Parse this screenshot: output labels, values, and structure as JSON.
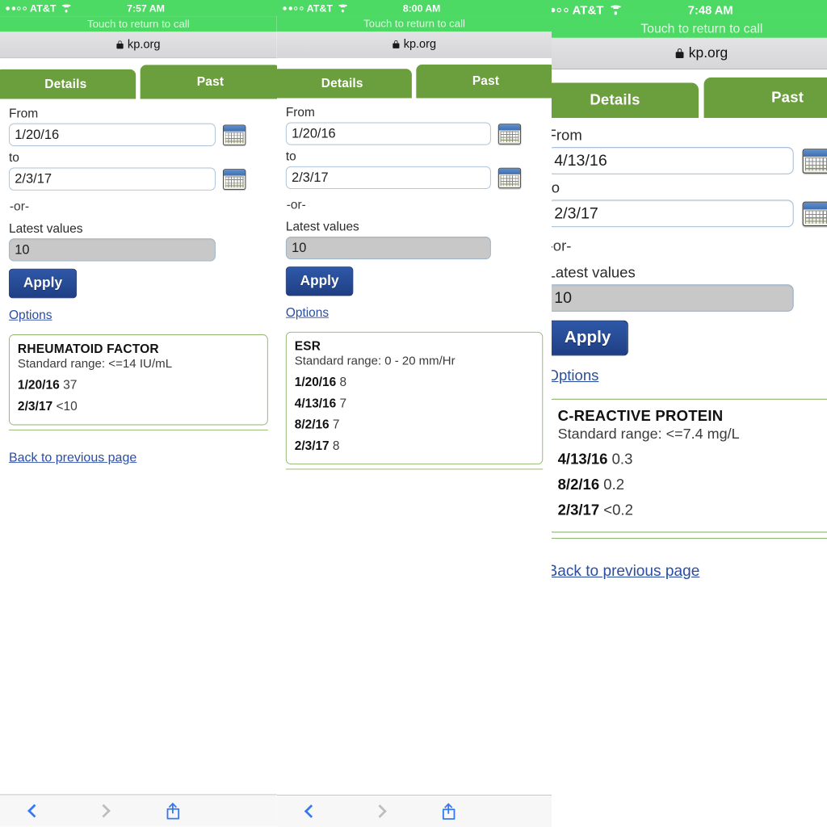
{
  "screens": [
    {
      "id": "screen-rheumatoid-factor",
      "status_bar": {
        "carrier": "AT&T",
        "time": "7:57 AM",
        "wifi_icon": "wifi-icon",
        "signal_dots_filled": 2,
        "signal_dots_total": 4
      },
      "call_banner": "Touch to return to call",
      "browser": {
        "url": "kp.org",
        "lock_icon": "lock-icon",
        "toolbar": {
          "back_icon": "chevron-left-icon",
          "forward_icon": "chevron-right-icon",
          "share_icon": "share-icon"
        }
      },
      "tabs": [
        {
          "label": "Details",
          "active": false
        },
        {
          "label": "Past",
          "active": true
        }
      ],
      "form": {
        "from_label": "From",
        "from_value": "1/20/16",
        "to_label": "to",
        "to_value": "2/3/17",
        "or_text": "-or-",
        "latest_values_label": "Latest values",
        "latest_values_value": "10",
        "apply_label": "Apply",
        "options_label": "Options",
        "calendar_icon": "calendar-icon"
      },
      "result_card": {
        "title": "RHEUMATOID FACTOR",
        "range": "Standard range: <=14 IU/mL",
        "rows": [
          {
            "date": "1/20/16",
            "value": "37"
          },
          {
            "date": "2/3/17",
            "value": "<10"
          }
        ]
      },
      "back_link": "Back to previous page"
    },
    {
      "id": "screen-esr",
      "status_bar": {
        "carrier": "AT&T",
        "time": "8:00 AM",
        "wifi_icon": "wifi-icon",
        "signal_dots_filled": 2,
        "signal_dots_total": 4
      },
      "call_banner": "Touch to return to call",
      "browser": {
        "url": "kp.org",
        "lock_icon": "lock-icon",
        "toolbar": {
          "back_icon": "chevron-left-icon",
          "forward_icon": "chevron-right-icon",
          "share_icon": "share-icon"
        }
      },
      "tabs": [
        {
          "label": "Details",
          "active": false
        },
        {
          "label": "Past",
          "active": true
        }
      ],
      "form": {
        "from_label": "From",
        "from_value": "1/20/16",
        "to_label": "to",
        "to_value": "2/3/17",
        "or_text": "-or-",
        "latest_values_label": "Latest values",
        "latest_values_value": "10",
        "apply_label": "Apply",
        "options_label": "Options",
        "calendar_icon": "calendar-icon"
      },
      "result_card": {
        "title": "ESR",
        "range": "Standard range: 0 - 20 mm/Hr",
        "rows": [
          {
            "date": "1/20/16",
            "value": "8"
          },
          {
            "date": "4/13/16",
            "value": "7"
          },
          {
            "date": "8/2/16",
            "value": "7"
          },
          {
            "date": "2/3/17",
            "value": "8"
          }
        ]
      },
      "back_link": ""
    },
    {
      "id": "screen-c-reactive-protein",
      "status_bar": {
        "carrier": "AT&T",
        "time": "7:48 AM",
        "wifi_icon": "wifi-icon",
        "signal_dots_filled": 2,
        "signal_dots_total": 4
      },
      "call_banner": "Touch to return to call",
      "browser": {
        "url": "kp.org",
        "lock_icon": "lock-icon",
        "toolbar": {
          "back_icon": "chevron-left-icon",
          "forward_icon": "chevron-right-icon",
          "share_icon": "share-icon"
        }
      },
      "tabs": [
        {
          "label": "Details",
          "active": false
        },
        {
          "label": "Past",
          "active": true
        }
      ],
      "form": {
        "from_label": "From",
        "from_value": "4/13/16",
        "to_label": "to",
        "to_value": "2/3/17",
        "or_text": "-or-",
        "latest_values_label": "Latest values",
        "latest_values_value": "10",
        "apply_label": "Apply",
        "options_label": "Options",
        "calendar_icon": "calendar-icon"
      },
      "result_card": {
        "title": "C-REACTIVE PROTEIN",
        "range": "Standard range: <=7.4 mg/L",
        "rows": [
          {
            "date": "4/13/16",
            "value": "0.3"
          },
          {
            "date": "8/2/16",
            "value": "0.2"
          },
          {
            "date": "2/3/17",
            "value": "<0.2"
          }
        ]
      },
      "back_link": "Back to previous page"
    }
  ],
  "colors": {
    "status_green": "#4cd964",
    "tab_green": "#6b9e3c",
    "apply_blue": "#2f58a8",
    "link_blue": "#2b4ea0",
    "card_border_green": "#8fb46b",
    "toolbar_blue": "#3478f6"
  }
}
